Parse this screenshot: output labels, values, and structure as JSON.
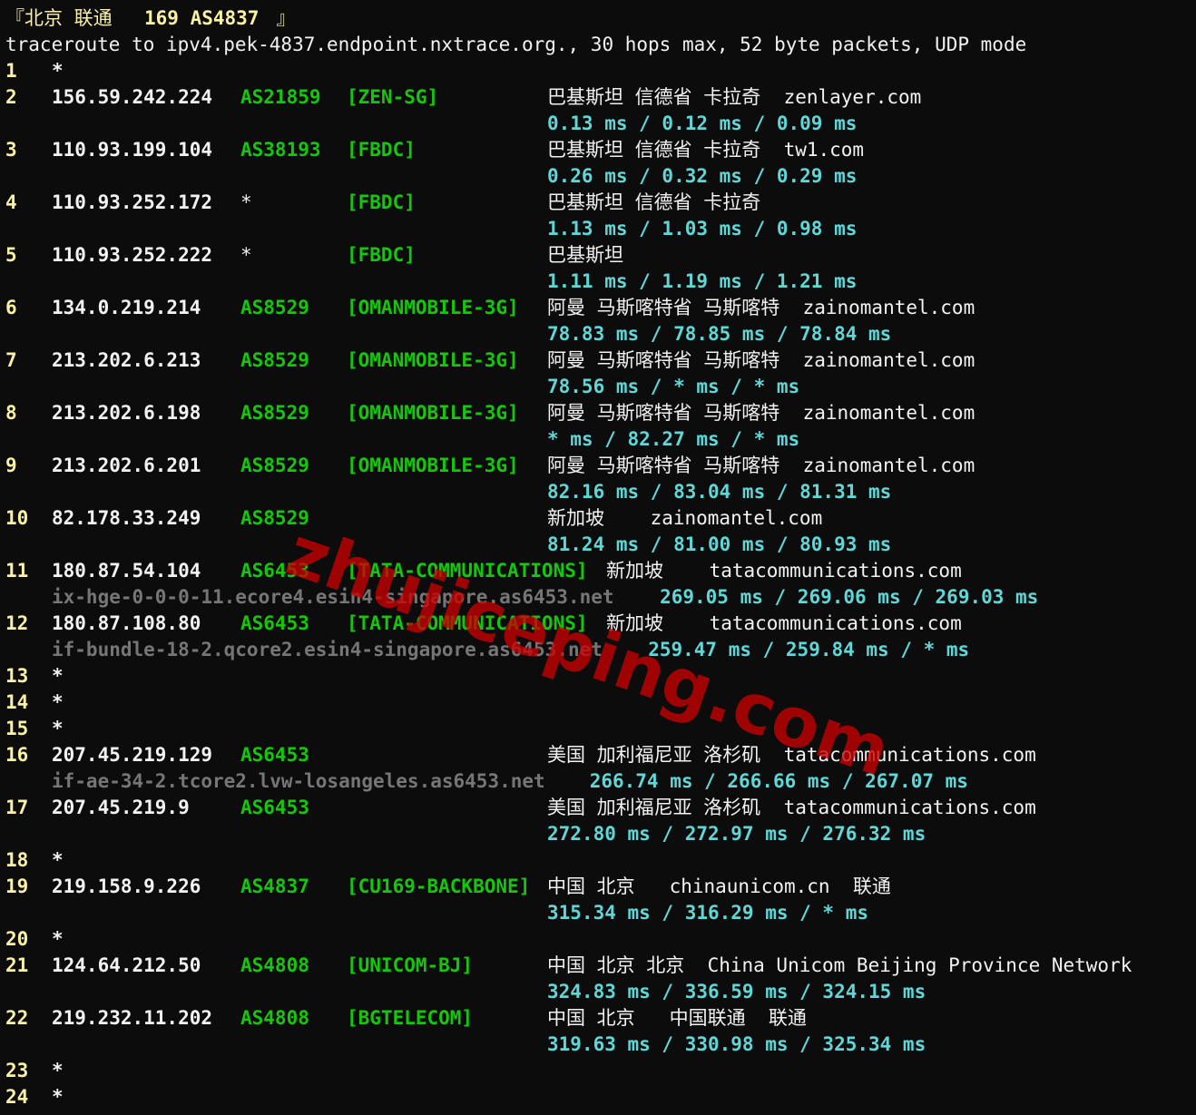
{
  "header": {
    "prefix": "『北京 联通 ",
    "bold": "169 AS4837",
    "suffix": " 』",
    "command": "traceroute to ipv4.pek-4837.endpoint.nxtrace.org., 30 hops max, 52 byte packets, UDP mode"
  },
  "watermark": "zhujiceping.com",
  "hops": [
    {
      "n": "1",
      "ip": "*"
    },
    {
      "n": "2",
      "ip": "156.59.242.224",
      "asn": "AS21859",
      "tag": "[ZEN-SG]",
      "loc": "巴基斯坦 信德省 卡拉奇  zenlayer.com",
      "rtt": "0.13 ms / 0.12 ms / 0.09 ms"
    },
    {
      "n": "3",
      "ip": "110.93.199.104",
      "asn": "AS38193",
      "tag": "[FBDC]",
      "loc": "巴基斯坦 信德省 卡拉奇  tw1.com",
      "rtt": "0.26 ms / 0.32 ms / 0.29 ms"
    },
    {
      "n": "4",
      "ip": "110.93.252.172",
      "asn": "*",
      "tag": "[FBDC]",
      "loc": "巴基斯坦 信德省 卡拉奇",
      "rtt": "1.13 ms / 1.03 ms / 0.98 ms"
    },
    {
      "n": "5",
      "ip": "110.93.252.222",
      "asn": "*",
      "tag": "[FBDC]",
      "loc": "巴基斯坦",
      "rtt": "1.11 ms / 1.19 ms / 1.21 ms"
    },
    {
      "n": "6",
      "ip": "134.0.219.214",
      "asn": "AS8529",
      "tag": "[OMANMOBILE-3G]",
      "loc": "阿曼 马斯喀特省 马斯喀特  zainomantel.com",
      "rtt": "78.83 ms / 78.85 ms / 78.84 ms"
    },
    {
      "n": "7",
      "ip": "213.202.6.213",
      "asn": "AS8529",
      "tag": "[OMANMOBILE-3G]",
      "loc": "阿曼 马斯喀特省 马斯喀特  zainomantel.com",
      "rtt": "78.56 ms / * ms / * ms"
    },
    {
      "n": "8",
      "ip": "213.202.6.198",
      "asn": "AS8529",
      "tag": "[OMANMOBILE-3G]",
      "loc": "阿曼 马斯喀特省 马斯喀特  zainomantel.com",
      "rtt": "* ms / 82.27 ms / * ms"
    },
    {
      "n": "9",
      "ip": "213.202.6.201",
      "asn": "AS8529",
      "tag": "[OMANMOBILE-3G]",
      "loc": "阿曼 马斯喀特省 马斯喀特  zainomantel.com",
      "rtt": "82.16 ms / 83.04 ms / 81.31 ms"
    },
    {
      "n": "10",
      "ip": "82.178.33.249",
      "asn": "AS8529",
      "loc": "新加坡    zainomantel.com",
      "rtt": "81.24 ms / 81.00 ms / 80.93 ms"
    },
    {
      "n": "11",
      "ip": "180.87.54.104",
      "asn": "AS6453",
      "tag": "[TATA-COMMUNICATIONS]",
      "loc": "新加坡    tatacommunications.com",
      "host": "ix-hge-0-0-0-11.ecore4.esin4-singapore.as6453.net",
      "rtt": "269.05 ms / 269.06 ms / 269.03 ms"
    },
    {
      "n": "12",
      "ip": "180.87.108.80",
      "asn": "AS6453",
      "tag": "[TATA-COMMUNICATIONS]",
      "loc": "新加坡    tatacommunications.com",
      "host": "if-bundle-18-2.qcore2.esin4-singapore.as6453.net",
      "rtt": "259.47 ms / 259.84 ms / * ms"
    },
    {
      "n": "13",
      "ip": "*"
    },
    {
      "n": "14",
      "ip": "*"
    },
    {
      "n": "15",
      "ip": "*"
    },
    {
      "n": "16",
      "ip": "207.45.219.129",
      "asn": "AS6453",
      "loc": "美国 加利福尼亚 洛杉矶  tatacommunications.com",
      "host": "if-ae-34-2.tcore2.lvw-losangeles.as6453.net",
      "rtt": "266.74 ms / 266.66 ms / 267.07 ms"
    },
    {
      "n": "17",
      "ip": "207.45.219.9",
      "asn": "AS6453",
      "loc": "美国 加利福尼亚 洛杉矶  tatacommunications.com",
      "rtt": "272.80 ms / 272.97 ms / 276.32 ms"
    },
    {
      "n": "18",
      "ip": "*"
    },
    {
      "n": "19",
      "ip": "219.158.9.226",
      "asn": "AS4837",
      "tag": "[CU169-BACKBONE]",
      "loc": "中国 北京   chinaunicom.cn  联通",
      "rtt": "315.34 ms / 316.29 ms / * ms"
    },
    {
      "n": "20",
      "ip": "*"
    },
    {
      "n": "21",
      "ip": "124.64.212.50",
      "asn": "AS4808",
      "tag": "[UNICOM-BJ]",
      "loc": "中国 北京 北京  China Unicom Beijing Province Network",
      "rtt": "324.83 ms / 336.59 ms / 324.15 ms"
    },
    {
      "n": "22",
      "ip": "219.232.11.202",
      "asn": "AS4808",
      "tag": "[BGTELECOM]",
      "loc": "中国 北京   中国联通  联通",
      "rtt": "319.63 ms / 330.98 ms / 325.34 ms"
    },
    {
      "n": "23",
      "ip": "*"
    },
    {
      "n": "24",
      "ip": "*"
    }
  ]
}
